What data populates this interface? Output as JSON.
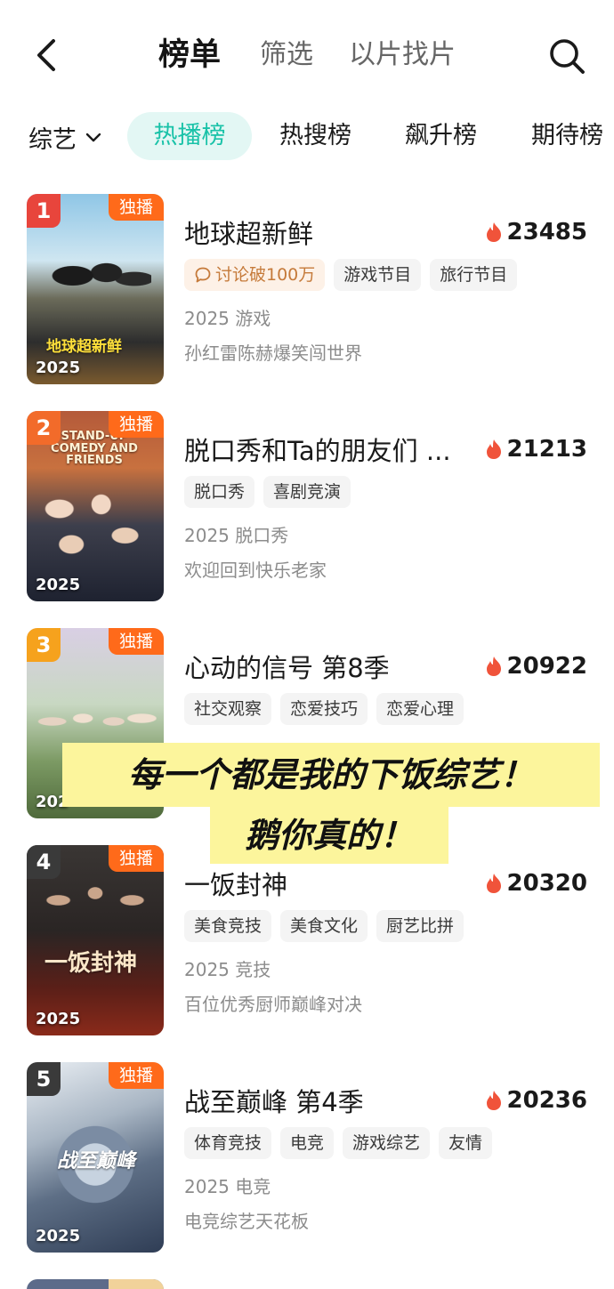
{
  "nav": {
    "tabs": [
      {
        "label": "榜单",
        "active": true
      },
      {
        "label": "筛选",
        "active": false
      },
      {
        "label": "以片找片",
        "active": false
      }
    ]
  },
  "filter": {
    "category": "综艺",
    "rank_tabs": [
      {
        "label": "热播榜",
        "active": true
      },
      {
        "label": "热搜榜",
        "active": false
      },
      {
        "label": "飙升榜",
        "active": false
      },
      {
        "label": "期待榜",
        "active": false
      }
    ]
  },
  "list": [
    {
      "rank": "1",
      "badge": "独播",
      "poster_year": "2025",
      "poster_text": "地球超新鲜",
      "title": "地球超新鲜",
      "heat": "23485",
      "discussion_tag": "讨论破100万",
      "tags": [
        "游戏节目",
        "旅行节目"
      ],
      "meta": "2025 游戏",
      "desc": "孙红雷陈赫爆笑闯世界"
    },
    {
      "rank": "2",
      "badge": "独播",
      "poster_year": "2025",
      "poster_text": "STAND-UP COMEDY AND FRIENDS",
      "title": "脱口秀和Ta的朋友们 ...",
      "heat": "21213",
      "tags": [
        "脱口秀",
        "喜剧竞演"
      ],
      "meta": "2025 脱口秀",
      "desc": "欢迎回到快乐老家"
    },
    {
      "rank": "3",
      "badge": "独播",
      "poster_year": "202",
      "poster_text": "",
      "title": "心动的信号 第8季",
      "heat": "20922",
      "tags": [
        "社交观察",
        "恋爱技巧",
        "恋爱心理"
      ],
      "meta": "",
      "desc": ""
    },
    {
      "rank": "4",
      "badge": "独播",
      "poster_year": "2025",
      "poster_text": "一饭封神",
      "title": "一饭封神",
      "heat": "20320",
      "tags": [
        "美食竞技",
        "美食文化",
        "厨艺比拼"
      ],
      "meta": "2025 竞技",
      "desc": "百位优秀厨师巅峰对决"
    },
    {
      "rank": "5",
      "badge": "独播",
      "poster_year": "2025",
      "poster_text": "战至巅峰",
      "title": "战至巅峰 第4季",
      "heat": "20236",
      "tags": [
        "体育竞技",
        "电竞",
        "游戏综艺",
        "友情"
      ],
      "meta": "2025 电竞",
      "desc": "电竞综艺天花板"
    }
  ],
  "overlay": {
    "line1": "每一个都是我的下饭综艺！",
    "line2": "鹅你真的！"
  },
  "colors": {
    "accent": "#19c2a8",
    "accent_bg": "#e3f7f4",
    "exclusive_badge": "#ff6a1a",
    "rank1": "#e8453c",
    "rank2": "#f26b2a",
    "rank3": "#f6a21d",
    "rank_other": "#3a3a3a",
    "heat_flame": "#f0533a",
    "overlay_bg": "#fcf59c"
  },
  "icons": [
    "back-arrow-icon",
    "search-icon",
    "chevron-down-icon",
    "flame-icon",
    "comment-bubble-icon"
  ]
}
